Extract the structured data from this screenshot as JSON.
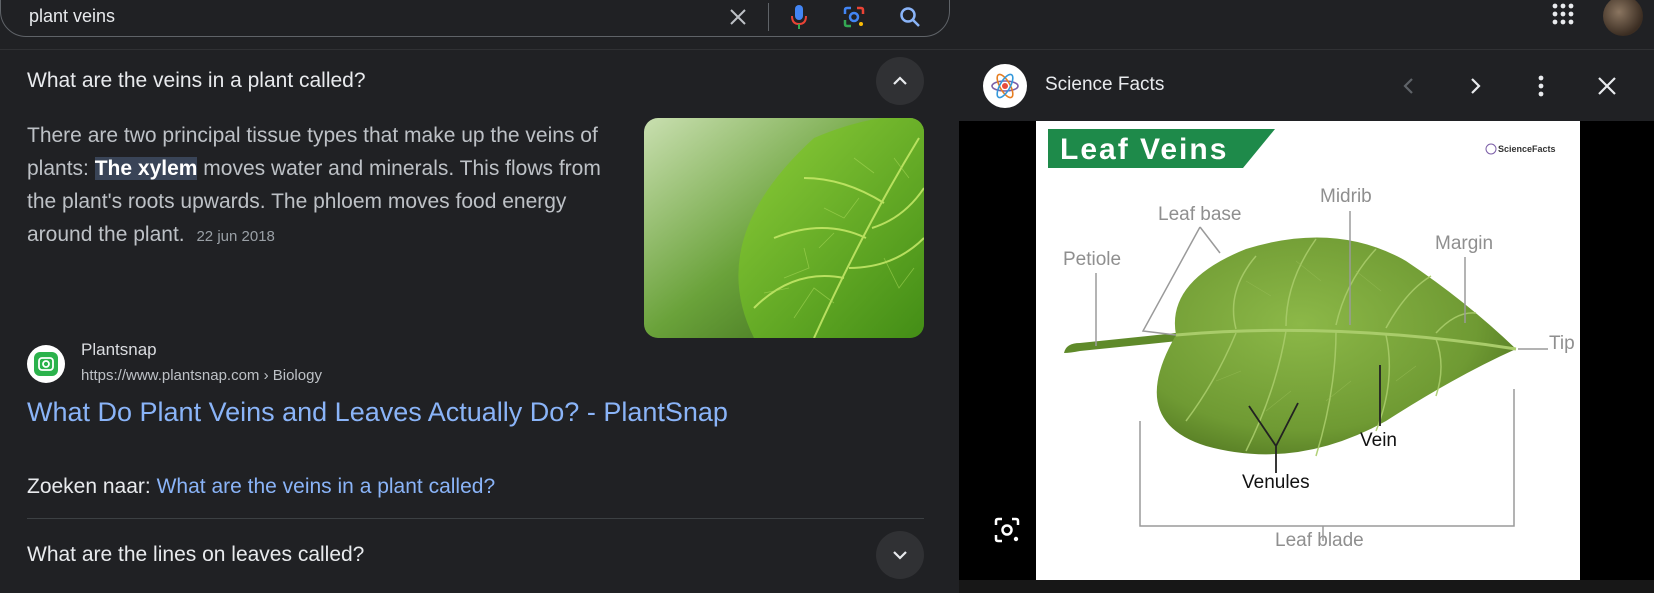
{
  "search": {
    "query": "plant veins"
  },
  "icons": {
    "clear": "close-icon",
    "voice": "microphone-icon",
    "lens": "camera-lens-icon",
    "search": "search-icon",
    "apps": "apps-grid-icon"
  },
  "faq": {
    "question1": "What are the veins in a plant called?",
    "answer_before": "There are two principal tissue types that make up the veins of plants: ",
    "answer_highlight": "The xylem",
    "answer_after": " moves water and minerals. This flows from the plant's roots upwards. The phloem moves food energy around the plant.",
    "answer_date": "22 jun 2018",
    "source_name": "Plantsnap",
    "source_url": "https://www.plantsnap.com › Biology",
    "result_title": "What Do Plant Veins and Leaves Actually Do? - PlantSnap",
    "search_for_label": "Zoeken naar:",
    "search_for_link": "What are the veins in a plant called?",
    "question2": "What are the lines on leaves called?"
  },
  "panel": {
    "source_name": "Science Facts",
    "figure": {
      "banner": "Leaf Veins",
      "brand": "ScienceFacts",
      "labels": {
        "petiole": "Petiole",
        "leaf_base": "Leaf base",
        "midrib": "Midrib",
        "margin": "Margin",
        "tip": "Tip",
        "vein": "Vein",
        "venules": "Venules",
        "leaf_blade": "Leaf blade"
      }
    }
  },
  "colors": {
    "background": "#202124",
    "link": "#8ab4f8",
    "leaf_green": "#7aa33a",
    "banner_green": "#1e8a4a"
  }
}
